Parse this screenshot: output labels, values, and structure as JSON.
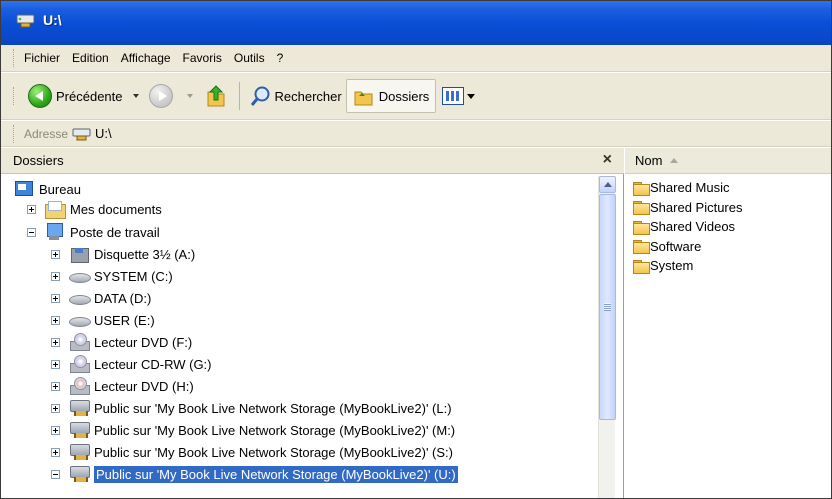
{
  "window": {
    "title": "U:\\"
  },
  "menu": [
    "Fichier",
    "Edition",
    "Affichage",
    "Favoris",
    "Outils",
    "?"
  ],
  "toolbar": {
    "back_label": "Précédente",
    "search_label": "Rechercher",
    "folders_label": "Dossiers"
  },
  "address": {
    "label": "Adresse",
    "value": "U:\\"
  },
  "folders_pane": {
    "header": "Dossiers",
    "close_glyph": "×",
    "tree": [
      {
        "label": "Bureau",
        "icon": "desktop-icon"
      },
      {
        "label": "Mes documents",
        "icon": "my-documents-icon",
        "expander": "plus"
      },
      {
        "label": "Poste de travail",
        "icon": "my-computer-icon",
        "expander": "minus"
      },
      {
        "label": "Disquette 3½ (A:)",
        "icon": "floppy-drive-icon",
        "expander": "plus"
      },
      {
        "label": "SYSTEM (C:)",
        "icon": "hard-drive-icon",
        "expander": "plus"
      },
      {
        "label": "DATA (D:)",
        "icon": "hard-drive-icon",
        "expander": "plus"
      },
      {
        "label": "USER (E:)",
        "icon": "hard-drive-icon",
        "expander": "plus"
      },
      {
        "label": "Lecteur DVD (F:)",
        "icon": "dvd-drive-icon",
        "expander": "plus"
      },
      {
        "label": "Lecteur CD-RW (G:)",
        "icon": "cd-rw-drive-icon",
        "expander": "plus"
      },
      {
        "label": "Lecteur DVD (H:)",
        "icon": "dvd-drive-icon",
        "expander": "plus"
      },
      {
        "label": "Public sur 'My Book Live Network Storage (MyBookLive2)' (L:)",
        "icon": "network-drive-icon",
        "expander": "plus"
      },
      {
        "label": "Public sur 'My Book Live Network Storage (MyBookLive2)' (M:)",
        "icon": "network-drive-icon",
        "expander": "plus"
      },
      {
        "label": "Public sur 'My Book Live Network Storage (MyBookLive2)' (S:)",
        "icon": "network-drive-icon",
        "expander": "plus"
      },
      {
        "label": "Public sur 'My Book Live Network Storage (MyBookLive2)' (U:)",
        "icon": "network-drive-icon",
        "expander": "minus",
        "selected": true
      }
    ]
  },
  "files_pane": {
    "column_header": "Nom",
    "items": [
      "Shared Music",
      "Shared Pictures",
      "Shared Videos",
      "Software",
      "System"
    ]
  }
}
